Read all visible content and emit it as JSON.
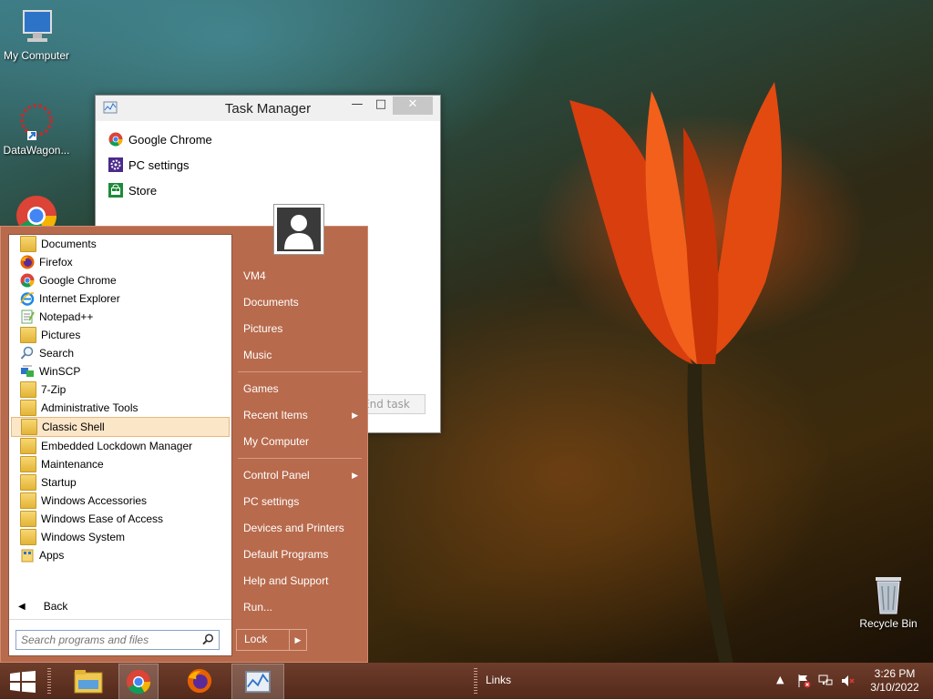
{
  "desktop": {
    "icons": [
      {
        "label": "My Computer",
        "icon": "computer-icon"
      },
      {
        "label": "DataWagon...",
        "icon": "datawagon-shortcut-icon"
      },
      {
        "label": "Recycle Bin",
        "icon": "recycle-bin-icon"
      }
    ]
  },
  "task_manager": {
    "title": "Task Manager",
    "min": "—",
    "max": "□",
    "close": "✕",
    "apps": [
      {
        "label": "Google Chrome",
        "icon": "chrome-icon"
      },
      {
        "label": "PC settings",
        "icon": "pc-settings-icon"
      },
      {
        "label": "Store",
        "icon": "store-icon"
      }
    ],
    "end_task": "End task"
  },
  "start_menu": {
    "programs": [
      {
        "label": "Documents",
        "icon": "documents-icon"
      },
      {
        "label": "Firefox",
        "icon": "firefox-icon"
      },
      {
        "label": "Google Chrome",
        "icon": "chrome-icon"
      },
      {
        "label": "Internet Explorer",
        "icon": "ie-icon"
      },
      {
        "label": "Notepad++",
        "icon": "notepadpp-icon"
      },
      {
        "label": "Pictures",
        "icon": "pictures-icon"
      },
      {
        "label": "Search",
        "icon": "search-icon"
      },
      {
        "label": "WinSCP",
        "icon": "winscp-icon"
      },
      {
        "label": "7-Zip",
        "icon": "folder-icon"
      },
      {
        "label": "Administrative Tools",
        "icon": "folder-icon"
      },
      {
        "label": "Classic Shell",
        "icon": "folder-icon"
      },
      {
        "label": "Embedded Lockdown Manager",
        "icon": "folder-icon"
      },
      {
        "label": "Maintenance",
        "icon": "folder-icon"
      },
      {
        "label": "Startup",
        "icon": "folder-icon"
      },
      {
        "label": "Windows Accessories",
        "icon": "folder-icon"
      },
      {
        "label": "Windows Ease of Access",
        "icon": "folder-icon"
      },
      {
        "label": "Windows System",
        "icon": "folder-icon"
      },
      {
        "label": "Apps",
        "icon": "apps-icon"
      }
    ],
    "selected_program": "Classic Shell",
    "back": "Back",
    "search_placeholder": "Search programs and files",
    "right_items": {
      "vm4": "VM4",
      "documents": "Documents",
      "pictures": "Pictures",
      "music": "Music",
      "games": "Games",
      "recent_items": "Recent Items",
      "my_computer": "My Computer",
      "control_panel": "Control Panel",
      "pc_settings": "PC settings",
      "devices_printers": "Devices and Printers",
      "default_programs": "Default Programs",
      "help_support": "Help and Support",
      "run": "Run..."
    },
    "lock": "Lock"
  },
  "taskbar": {
    "links": "Links",
    "time": "3:26 PM",
    "date": "3/10/2022",
    "apps": [
      "file-explorer-icon",
      "chrome-icon",
      "firefox-icon",
      "task-manager-icon"
    ]
  },
  "colors": {
    "start_menu_bg": "#b86a4c",
    "taskbar_bg": "#5e3020",
    "selected_item_bg": "#fbe6c8"
  }
}
